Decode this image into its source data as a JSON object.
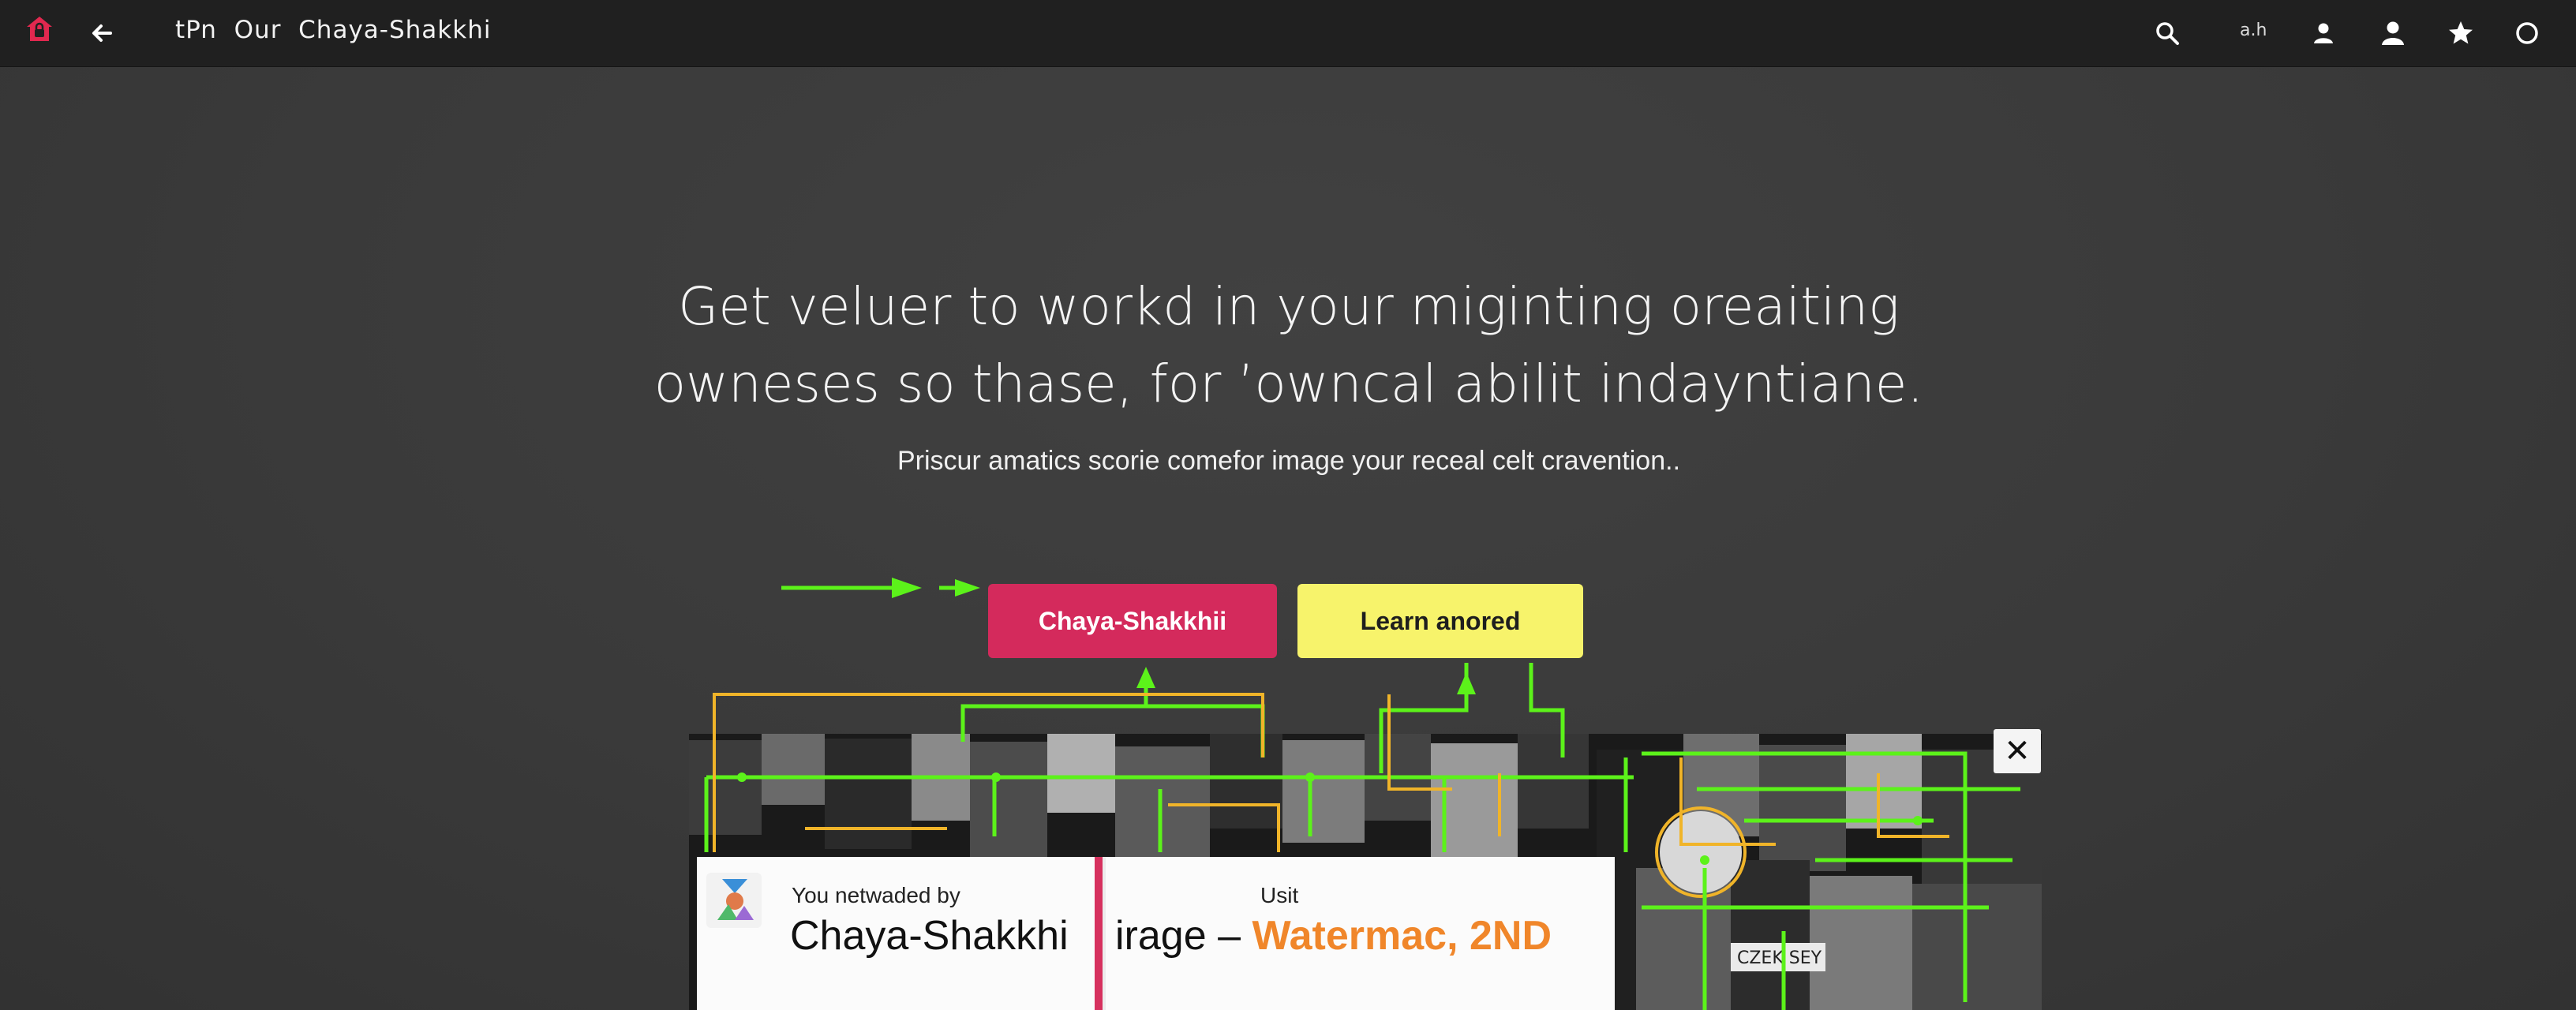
{
  "app": {
    "title": "tPn  Our  Chaya-Shakkhi",
    "small_label": "a.h"
  },
  "icons": {
    "logo": "home-lock-icon",
    "back": "arrow-left-icon",
    "search": "search-icon",
    "user": "user-icon",
    "profile": "profile-icon",
    "star": "star-icon",
    "circle": "circle-icon",
    "close": "close-icon"
  },
  "colors": {
    "accent": "#d42a5c",
    "secondary": "#f7f36b",
    "overlay_line": "#5cf21a",
    "overlay_line_alt": "#f0b429",
    "watermark": "#f0862a"
  },
  "hero": {
    "title_line1": "Get veluer to workd in your miginting oreaiting",
    "title_line2": "owneses so thase, for ’owncal abilit indayntiane.",
    "subtitle": "Priscur amatics scorie comefor image your receal celt cravention.."
  },
  "buttons": {
    "primary": "Chaya-Shakkhii",
    "secondary": "Learn anored"
  },
  "close_label": "✕",
  "collage_label": "CZEK SEY",
  "card": {
    "by_label": "You netwaded by",
    "name": "Chaya-Shakkhi",
    "unit_label": "Usit",
    "image_label": "irage – ",
    "watermark_text": "Watermac, 2ND"
  }
}
